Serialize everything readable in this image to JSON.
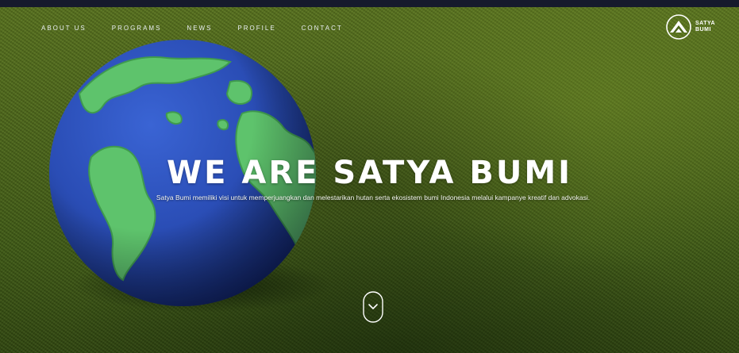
{
  "nav": {
    "items": [
      {
        "label": "ABOUT US"
      },
      {
        "label": "PROGRAMS"
      },
      {
        "label": "NEWS"
      },
      {
        "label": "PROFILE"
      },
      {
        "label": "CONTACT"
      }
    ]
  },
  "logo": {
    "line1": "SATYA",
    "line2": "BUMI",
    "icon": "mountain-circle-icon"
  },
  "hero": {
    "title": "WE ARE SATYA BUMI",
    "subtitle": "Satya Bumi memiliki visi untuk memperjuangkan dan melestarikan hutan serta ekosistem bumi Indonesia melalui kampanye kreatif dan advokasi."
  },
  "scroll": {
    "icon": "chevron-down-icon"
  },
  "colors": {
    "text": "#ffffff",
    "ocean": "#2b4fb8",
    "land": "#5cbf6a",
    "grass": "#4c661b"
  }
}
